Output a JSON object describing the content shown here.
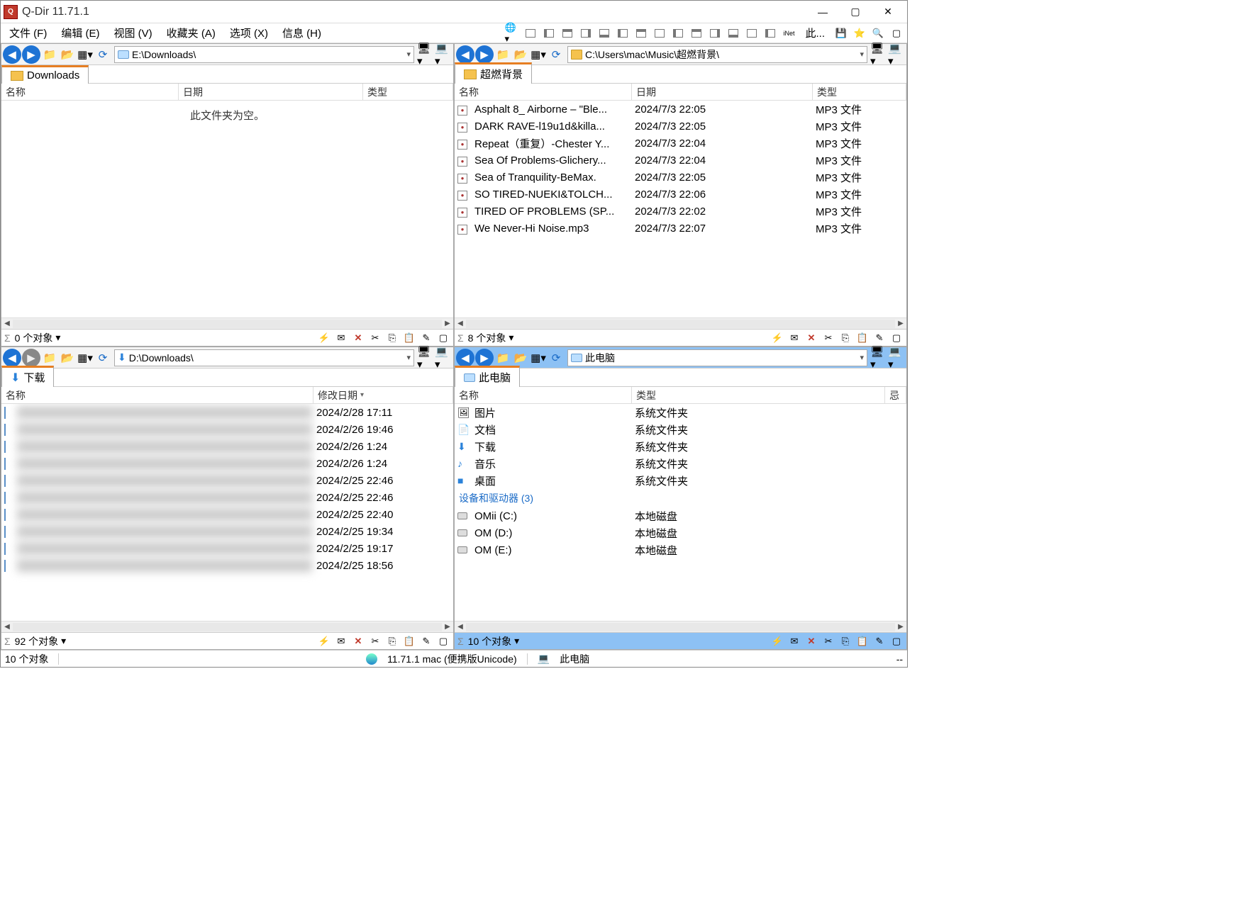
{
  "app": {
    "title": "Q-Dir 11.71.1"
  },
  "menu": {
    "file": "文件 (F)",
    "edit": "编辑 (E)",
    "view": "视图 (V)",
    "favorites": "收藏夹 (A)",
    "options": "选项 (X)",
    "info": "信息 (H)",
    "here": "此..."
  },
  "columns": {
    "name": "名称",
    "date": "日期",
    "moddate": "修改日期",
    "type": "类型"
  },
  "panes": {
    "tl": {
      "path": "E:\\Downloads\\",
      "tab": "Downloads",
      "empty": "此文件夹为空。",
      "status": "0 个对象"
    },
    "tr": {
      "path": "C:\\Users\\mac\\Music\\超燃背景\\",
      "tab": "超燃背景",
      "status": "8 个对象",
      "files": [
        {
          "name": "Asphalt 8_ Airborne – \"Ble...",
          "date": "2024/7/3 22:05",
          "type": "MP3 文件"
        },
        {
          "name": "DARK RAVE-l19u1d&killa...",
          "date": "2024/7/3 22:05",
          "type": "MP3 文件"
        },
        {
          "name": "Repeat（重复）-Chester Y...",
          "date": "2024/7/3 22:04",
          "type": "MP3 文件"
        },
        {
          "name": "Sea Of Problems-Glichery...",
          "date": "2024/7/3 22:04",
          "type": "MP3 文件"
        },
        {
          "name": "Sea of Tranquility-BeMax.",
          "date": "2024/7/3 22:05",
          "type": "MP3 文件"
        },
        {
          "name": "SO TIRED-NUEKI&TOLCH...",
          "date": "2024/7/3 22:06",
          "type": "MP3 文件"
        },
        {
          "name": "TIRED OF PROBLEMS (SP...",
          "date": "2024/7/3 22:02",
          "type": "MP3 文件"
        },
        {
          "name": "We Never-Hi Noise.mp3",
          "date": "2024/7/3 22:07",
          "type": "MP3 文件"
        }
      ]
    },
    "bl": {
      "path": "D:\\Downloads\\",
      "tab": "下载",
      "status": "92 个对象",
      "files": [
        {
          "date": "2024/2/28 17:11"
        },
        {
          "date": "2024/2/26 19:46"
        },
        {
          "date": "2024/2/26 1:24"
        },
        {
          "date": "2024/2/26 1:24"
        },
        {
          "date": "2024/2/25 22:46"
        },
        {
          "date": "2024/2/25 22:46"
        },
        {
          "date": "2024/2/25 22:40"
        },
        {
          "date": "2024/2/25 19:34"
        },
        {
          "date": "2024/2/25 19:17"
        },
        {
          "date": "2024/2/25 18:56"
        }
      ]
    },
    "br": {
      "path": "此电脑",
      "tab": "此电脑",
      "status": "10 个对象",
      "group": "设备和驱动器 (3)",
      "items": [
        {
          "icon": "🖼",
          "name": "图片",
          "type": "系统文件夹"
        },
        {
          "icon": "📄",
          "name": "文档",
          "type": "系统文件夹"
        },
        {
          "icon": "⬇",
          "name": "下载",
          "type": "系统文件夹"
        },
        {
          "icon": "♪",
          "name": "音乐",
          "type": "系统文件夹"
        },
        {
          "icon": "■",
          "name": "桌面",
          "type": "系统文件夹"
        }
      ],
      "drives": [
        {
          "name": "OMii (C:)",
          "type": "本地磁盘"
        },
        {
          "name": "OM (D:)",
          "type": "本地磁盘"
        },
        {
          "name": "OM (E:)",
          "type": "本地磁盘"
        }
      ]
    }
  },
  "statusbar": {
    "objects": "10 个对象",
    "version": "11.71.1 mac (便携版Unicode)",
    "location": "此电脑",
    "dash": "--"
  }
}
